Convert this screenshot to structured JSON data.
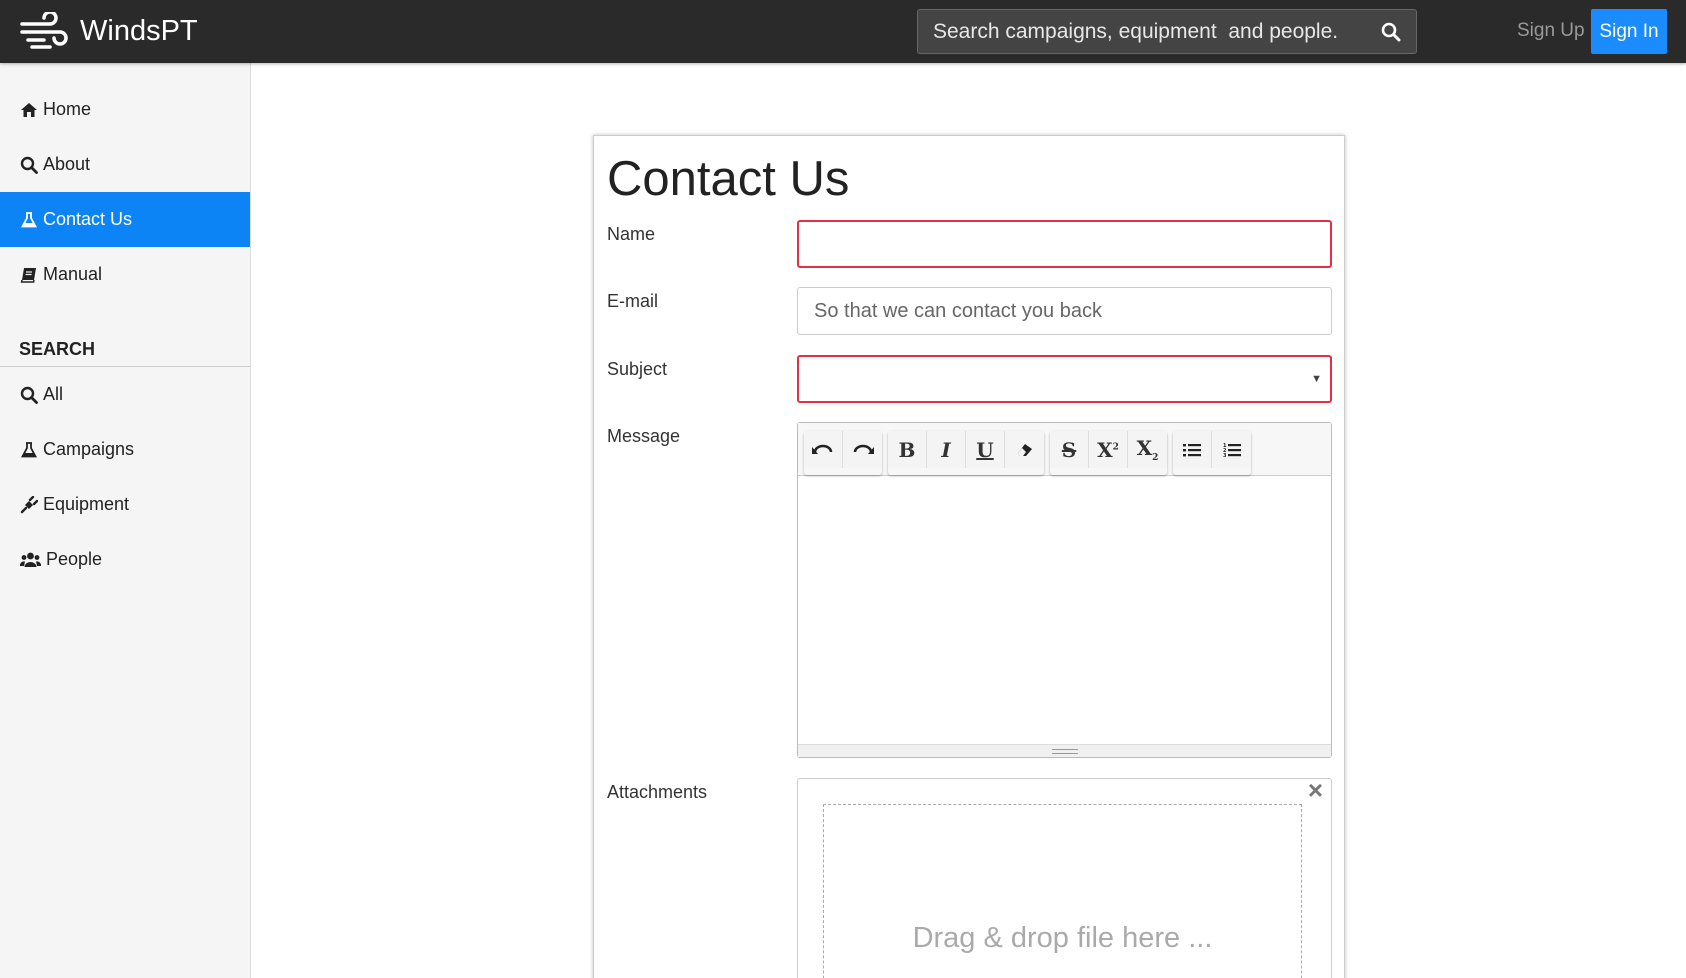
{
  "brand": {
    "name": "WindsPT"
  },
  "search": {
    "placeholder": "Search campaigns, equipment  and people."
  },
  "auth": {
    "signup": "Sign Up",
    "signin": "Sign In"
  },
  "sidebar": {
    "nav": [
      {
        "label": "Home",
        "icon": "home-icon"
      },
      {
        "label": "About",
        "icon": "search-icon"
      },
      {
        "label": "Contact Us",
        "icon": "flask-icon"
      },
      {
        "label": "Manual",
        "icon": "book-icon"
      }
    ],
    "search_header": "SEARCH",
    "search_items": [
      {
        "label": "All",
        "icon": "search-icon"
      },
      {
        "label": "Campaigns",
        "icon": "flask-icon"
      },
      {
        "label": "Equipment",
        "icon": "plug-icon"
      },
      {
        "label": "People",
        "icon": "users-icon"
      }
    ],
    "active": "Contact Us"
  },
  "form": {
    "title": "Contact Us",
    "name_label": "Name",
    "name_value": "",
    "email_label": "E-mail",
    "email_placeholder": "So that we can contact you back",
    "subject_label": "Subject",
    "subject_value": "",
    "message_label": "Message",
    "attachments_label": "Attachments",
    "dropzone_text": "Drag & drop file here ..."
  },
  "colors": {
    "navbar": "#2a2a2a",
    "accent": "#0d84f6",
    "invalid": "#e0314b"
  }
}
